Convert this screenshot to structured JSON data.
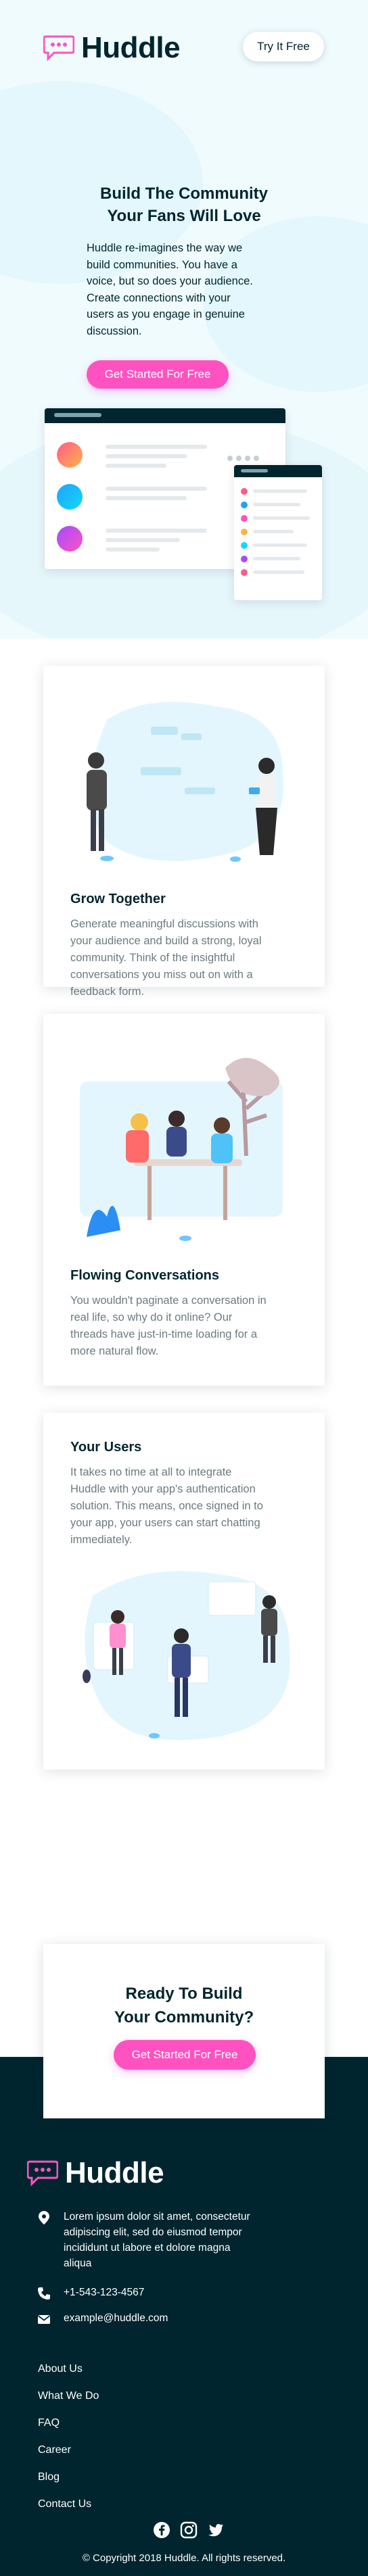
{
  "brand": {
    "name": "Huddle",
    "pink": "#ff52c1",
    "dark": "#00252e"
  },
  "header": {
    "try_label": "Try It Free"
  },
  "hero": {
    "title_line1": "Build The Community",
    "title_line2": "Your Fans Will Love",
    "desc_lines": [
      "Huddle re-imagines the way we",
      "build communities. You have a",
      "voice, but so does your audience.",
      "Create connections with your",
      "users as you engage in genuine",
      "discussion."
    ],
    "cta_label": "Get Started For Free"
  },
  "features": [
    {
      "title": "Grow Together",
      "lines": [
        "Generate meaningful discussions with",
        "your audience and build a strong, loyal",
        "community. Think of the insightful",
        "conversations you miss out on with a",
        "feedback form."
      ]
    },
    {
      "title": "Flowing Conversations",
      "lines": [
        "You wouldn't paginate a conversation in",
        "real life, so why do it online? Our",
        "threads have just-in-time loading for a",
        "more natural flow."
      ]
    },
    {
      "title": "Your Users",
      "lines": [
        "It takes no time at all to integrate",
        "Huddle with your app's authentication",
        "solution. This means, once signed in to",
        "your app, your users can start chatting",
        "immediately."
      ]
    }
  ],
  "cta": {
    "title_line1": "Ready To Build",
    "title_line2": "Your Community?",
    "button_label": "Get Started For Free"
  },
  "footer": {
    "address_lines": [
      "Lorem ipsum dolor sit amet, consectetur",
      "adipiscing elit, sed do eiusmod tempor",
      "incididunt ut labore et dolore magna",
      "aliqua"
    ],
    "phone": "+1-543-123-4567",
    "email": "example@huddle.com",
    "links": [
      "About Us",
      "What We Do",
      "FAQ",
      "Career",
      "Blog",
      "Contact Us"
    ],
    "social": [
      "facebook-icon",
      "instagram-icon",
      "twitter-icon"
    ],
    "copyright": "© Copyright 2018 Huddle. All rights reserved."
  }
}
